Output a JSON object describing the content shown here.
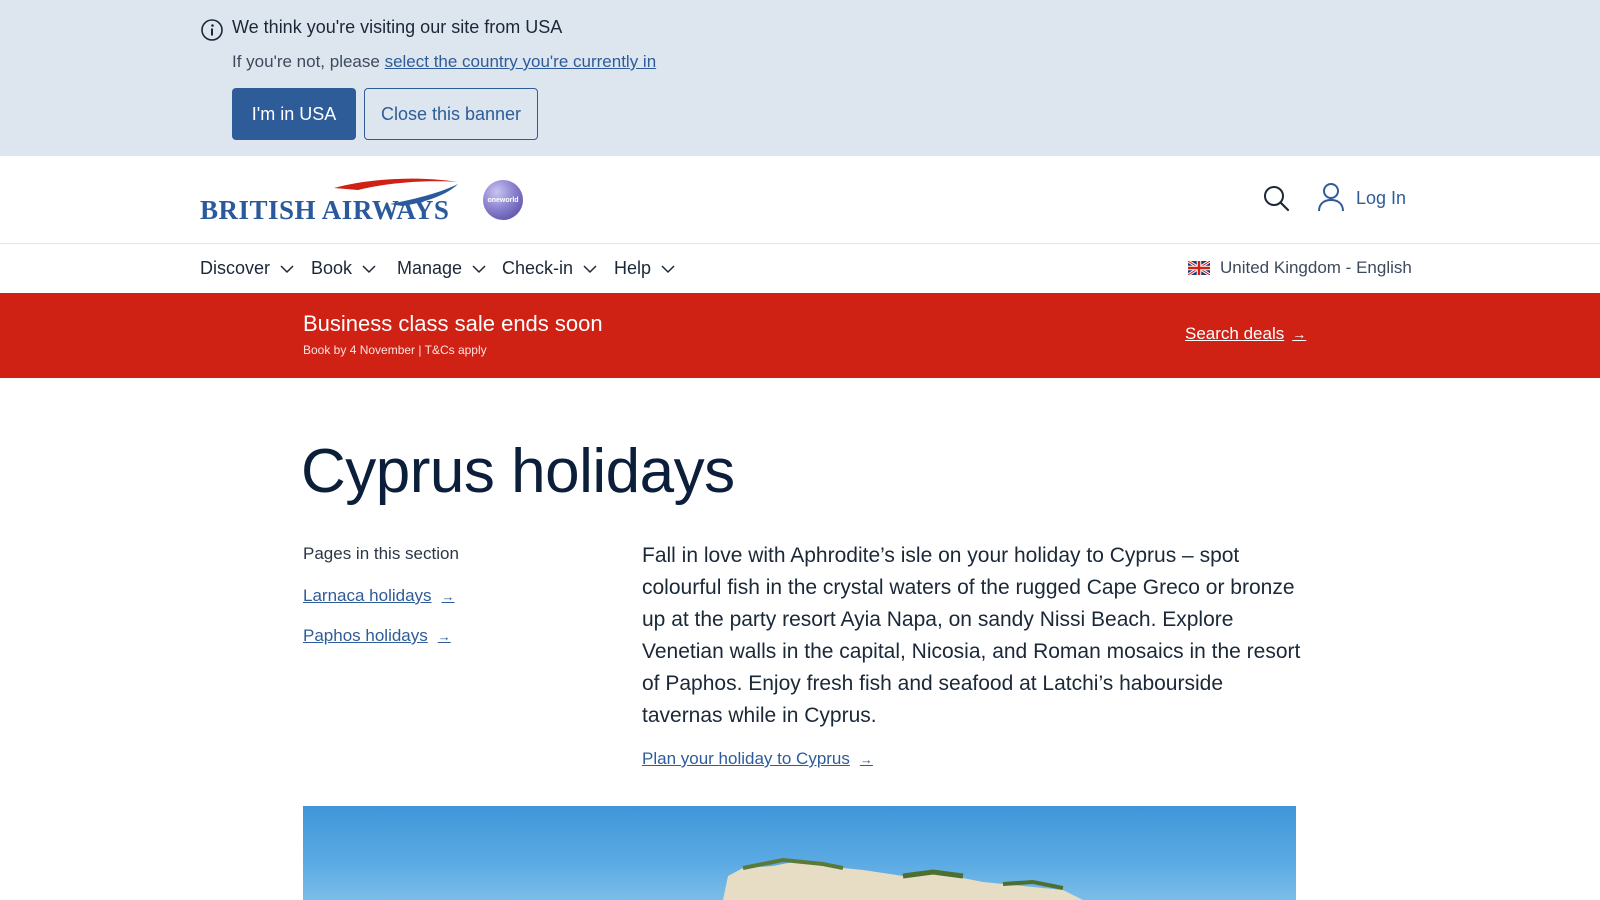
{
  "banner": {
    "title": "We think you're visiting our site from USA",
    "prefix": "If you're not, please ",
    "link_text": "select the country you're currently in",
    "primary_button": "I'm in USA",
    "close_button": "Close this banner"
  },
  "header": {
    "logo_text": "BRITISH AIRWAYS",
    "alliance": "oneworld",
    "login_label": "Log In"
  },
  "nav": {
    "items": [
      {
        "label": "Discover"
      },
      {
        "label": "Book"
      },
      {
        "label": "Manage"
      },
      {
        "label": "Check-in"
      },
      {
        "label": "Help"
      }
    ],
    "locale": "United Kingdom - English"
  },
  "promo": {
    "title": "Business class sale ends soon",
    "subtitle": "Book by 4 November | T&Cs apply",
    "link": "Search deals"
  },
  "main": {
    "title": "Cyprus holidays",
    "section_heading": "Pages in this section",
    "side_links": [
      {
        "label": "Larnaca holidays"
      },
      {
        "label": "Paphos holidays"
      }
    ],
    "intro": "Fall in love with Aphrodite’s isle on your holiday to Cyprus – spot colourful fish in the crystal waters of the rugged Cape Greco or bronze up at the party resort Ayia Napa, on sandy Nissi Beach. Explore Venetian walls in the capital, Nicosia, and Roman mosaics in the resort of Paphos. Enjoy fresh fish and seafood at Latchi’s habourside tavernas while in Cyprus.",
    "plan_link": "Plan your holiday to Cyprus"
  },
  "colors": {
    "brand_blue": "#2e5c99",
    "promo_red": "#cf2114",
    "banner_bg": "#dde6ef"
  }
}
